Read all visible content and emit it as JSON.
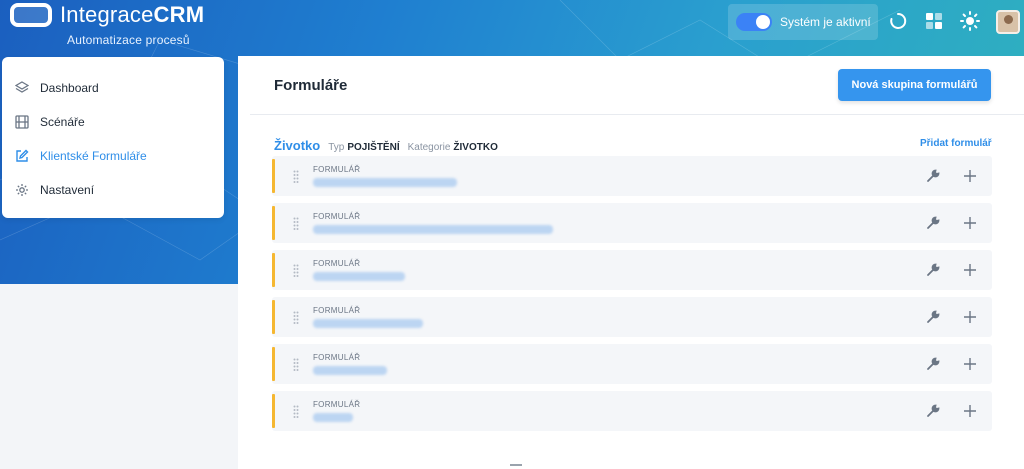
{
  "header": {
    "brand_light": "Integrace",
    "brand_bold": "CRM",
    "tagline": "Automatizace procesů",
    "status_label": "Systém je aktivní",
    "status_on": true
  },
  "sidebar": {
    "items": [
      {
        "label": "Dashboard",
        "icon": "layers-icon",
        "active": false
      },
      {
        "label": "Scénáře",
        "icon": "film-icon",
        "active": false
      },
      {
        "label": "Klientské Formuláře",
        "icon": "edit-icon",
        "active": true
      },
      {
        "label": "Nastavení",
        "icon": "gear-icon",
        "active": false
      }
    ]
  },
  "main": {
    "title": "Formuláře",
    "new_group_button": "Nová skupina formulářů",
    "group": {
      "name": "Životko",
      "type_label": "Typ",
      "type_value": "POJIŠTĚNÍ",
      "category_label": "Kategorie",
      "category_value": "ŽIVOTKO",
      "add_form_link": "Přidat formulář",
      "forms": [
        {
          "label": "FORMULÁŘ"
        },
        {
          "label": "FORMULÁŘ"
        },
        {
          "label": "FORMULÁŘ"
        },
        {
          "label": "FORMULÁŘ"
        },
        {
          "label": "FORMULÁŘ"
        },
        {
          "label": "FORMULÁŘ"
        }
      ]
    }
  },
  "colors": {
    "accent": "#2f8ee8",
    "primary_button": "#3595ee",
    "row_bar": "#f5b731"
  }
}
